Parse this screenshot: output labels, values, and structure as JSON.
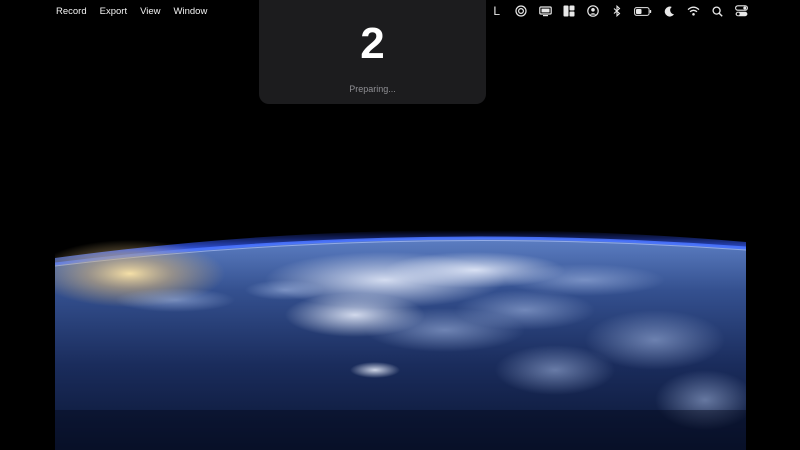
{
  "menu": {
    "items": [
      "Record",
      "Export",
      "View",
      "Window"
    ]
  },
  "status_bar": {
    "letter": "L",
    "icons": [
      "focus-target-icon",
      "display-icon",
      "layout-icon",
      "user-circle-icon",
      "bluetooth-icon",
      "battery-icon",
      "moon-icon",
      "wifi-icon",
      "search-icon",
      "control-center-icon"
    ]
  },
  "countdown": {
    "number": "2",
    "status": "Preparing..."
  },
  "colors": {
    "overlay_bg": "#1c1c1e",
    "status_text": "#8e8e93",
    "atmosphere": "#2f5cff"
  }
}
